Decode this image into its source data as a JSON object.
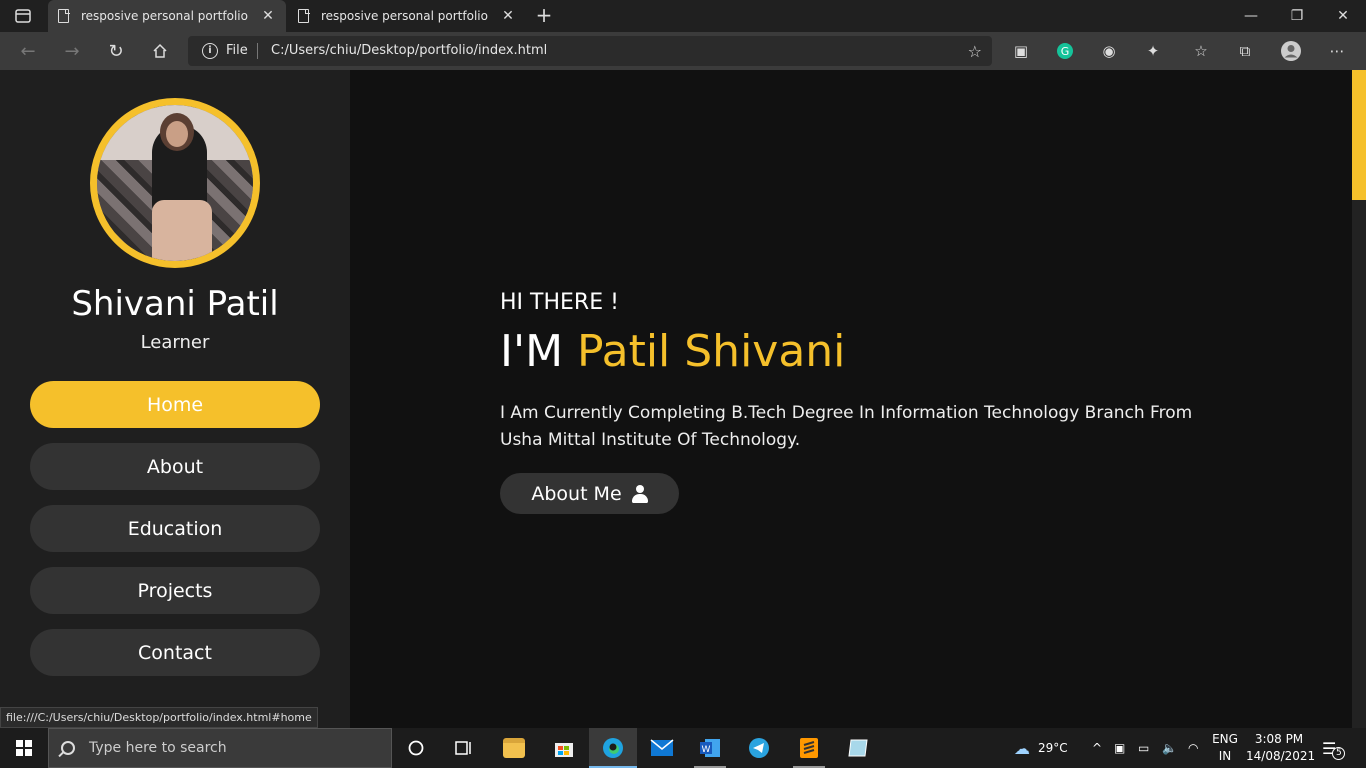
{
  "browser": {
    "tabs": [
      {
        "title": "resposive personal portfolio",
        "active": true
      },
      {
        "title": "resposive personal portfolio",
        "active": false
      }
    ],
    "new_tab_symbol": "+",
    "address": {
      "scheme_label": "File",
      "url": "C:/Users/chiu/Desktop/portfolio/index.html"
    },
    "status_link": "file:///C:/Users/chiu/Desktop/portfolio/index.html#home"
  },
  "sidebar": {
    "name": "Shivani Patil",
    "role": "Learner",
    "nav": [
      {
        "label": "Home",
        "active": true
      },
      {
        "label": "About",
        "active": false
      },
      {
        "label": "Education",
        "active": false
      },
      {
        "label": "Projects",
        "active": false
      },
      {
        "label": "Contact",
        "active": false
      }
    ]
  },
  "hero": {
    "greeting": "HI THERE !",
    "im_prefix": "I'M",
    "highlight_name": "Patil Shivani",
    "description": "I Am Currently Completing B.Tech Degree In Information Technology Branch From Usha Mittal Institute Of Technology.",
    "button_label": "About Me"
  },
  "colors": {
    "accent": "#f5c02b",
    "sidebar_bg": "#1f1f1f",
    "main_bg": "#111111",
    "button_bg": "#333333"
  },
  "taskbar": {
    "search_placeholder": "Type here to search",
    "weather": "29°C",
    "lang_line1": "ENG",
    "lang_line2": "IN",
    "time": "3:08 PM",
    "date": "14/08/2021",
    "notifications": "5"
  }
}
